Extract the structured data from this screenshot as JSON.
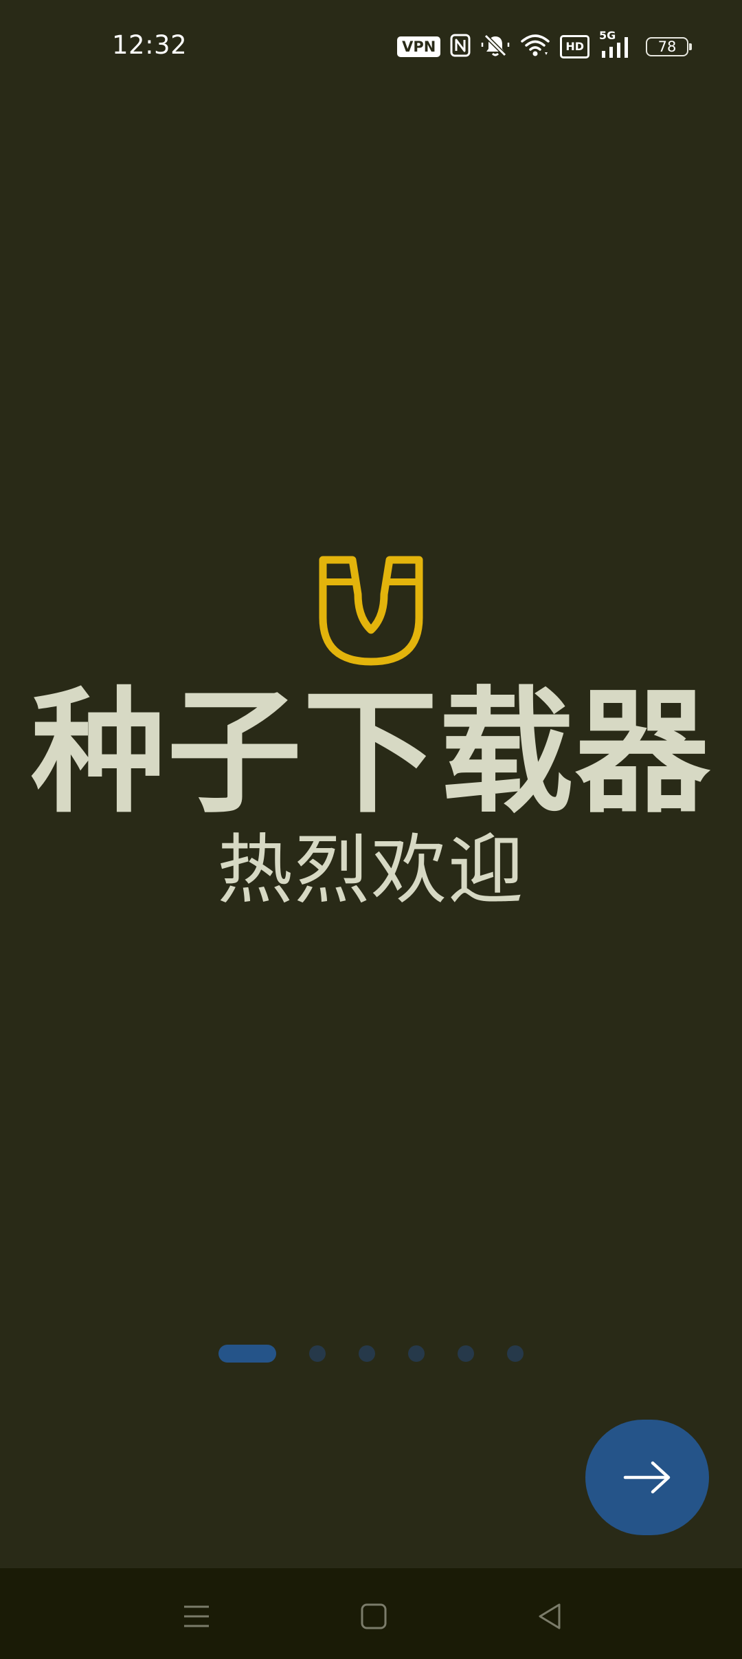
{
  "status_bar": {
    "time": "12:32",
    "vpn_label": "VPN",
    "hd_label": "HD",
    "network_label": "5G",
    "battery_level": "78",
    "icons": [
      "nfc-icon",
      "mute-icon",
      "wifi-icon",
      "signal-icon",
      "battery-icon"
    ]
  },
  "splash": {
    "logo_icon": "magnet-icon",
    "title": "种子下载器",
    "subtitle": "热烈欢迎"
  },
  "pager": {
    "total_pages": 6,
    "current_page": 1
  },
  "next_button": {
    "icon": "arrow-right-icon"
  },
  "nav_bar": {
    "icons": [
      "menu-icon",
      "home-icon",
      "back-icon"
    ]
  },
  "colors": {
    "background": "#292a17",
    "title_text": "#d7d9c4",
    "accent_yellow": "#e3b40c",
    "accent_blue": "#255489",
    "dot_inactive": "#26394a",
    "nav_bar": "#1a1b06"
  }
}
